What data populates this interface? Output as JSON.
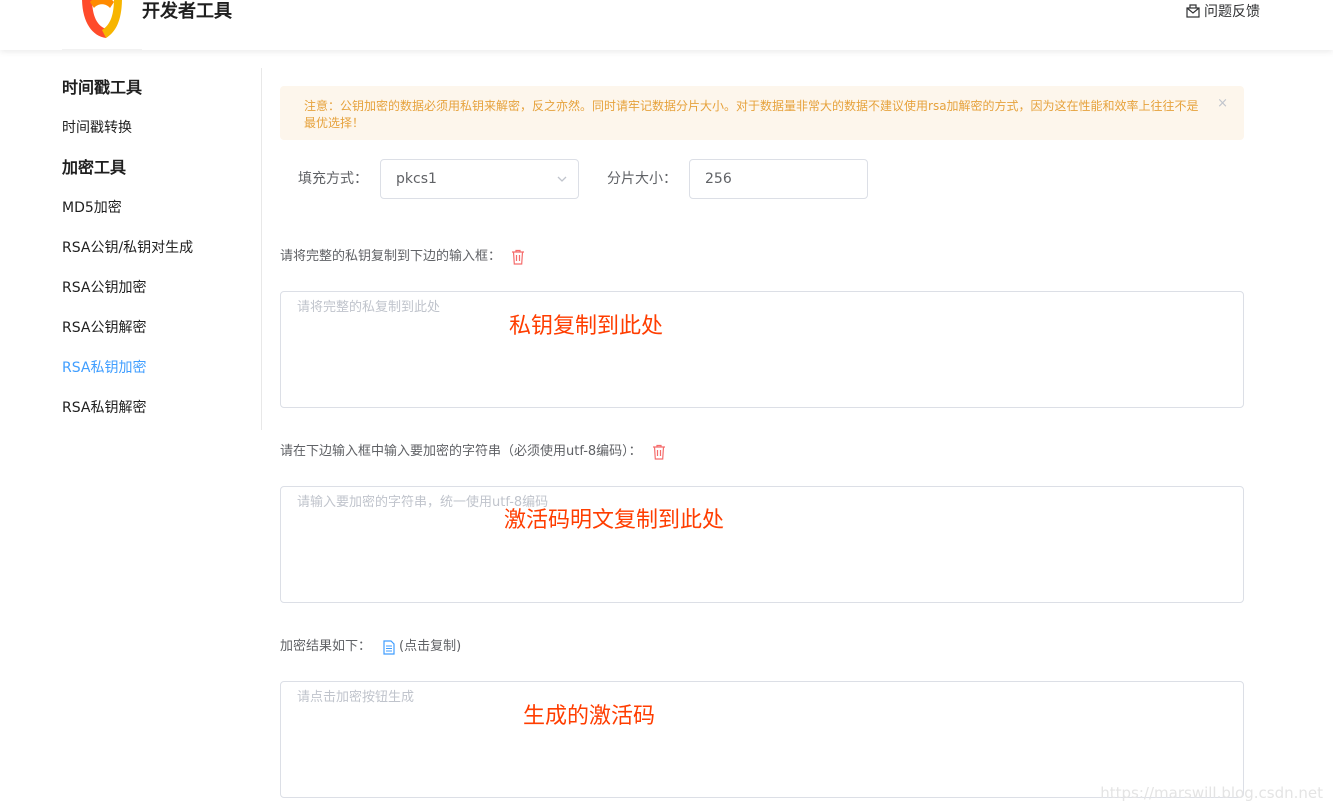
{
  "header": {
    "title": "开发者工具",
    "feedback_label": "问题反馈"
  },
  "sidebar": {
    "groups": [
      {
        "title": "时间戳工具",
        "items": [
          "时间戳转换"
        ]
      },
      {
        "title": "加密工具",
        "items": [
          "MD5加密",
          "RSA公钥/私钥对生成",
          "RSA公钥加密",
          "RSA公钥解密",
          "RSA私钥加密",
          "RSA私钥解密"
        ]
      }
    ],
    "active_item": "RSA私钥加密"
  },
  "alert": {
    "text": "注意：公钥加密的数据必须用私钥来解密，反之亦然。同时请牢记数据分片大小。对于数据量非常大的数据不建议使用rsa加解密的方式，因为这在性能和效率上往往不是最优选择！",
    "close_symbol": "×"
  },
  "form": {
    "padding_label": "填充方式：",
    "padding_value": "pkcs1",
    "chunk_label": "分片大小：",
    "chunk_value": "256"
  },
  "key_section": {
    "label": "请将完整的私钥复制到下边的输入框：",
    "placeholder": "请将完整的私复制到此处",
    "annotation": "私钥复制到此处"
  },
  "input_section": {
    "label": "请在下边输入框中输入要加密的字符串（必须使用utf-8编码）：",
    "placeholder": "请输入要加密的字符串，统一使用utf-8编码",
    "annotation": "激活码明文复制到此处"
  },
  "result_section": {
    "label": "加密结果如下：",
    "copy_label": "(点击复制)",
    "placeholder": "请点击加密按钮生成",
    "annotation": "生成的激活码"
  },
  "watermark": "https://marswill.blog.csdn.net",
  "colors": {
    "accent": "#409eff",
    "warning_text": "#e6a23c",
    "warning_bg": "#fdf6ec",
    "delete_icon": "#f56c6c",
    "annotation": "#ff3d00"
  }
}
